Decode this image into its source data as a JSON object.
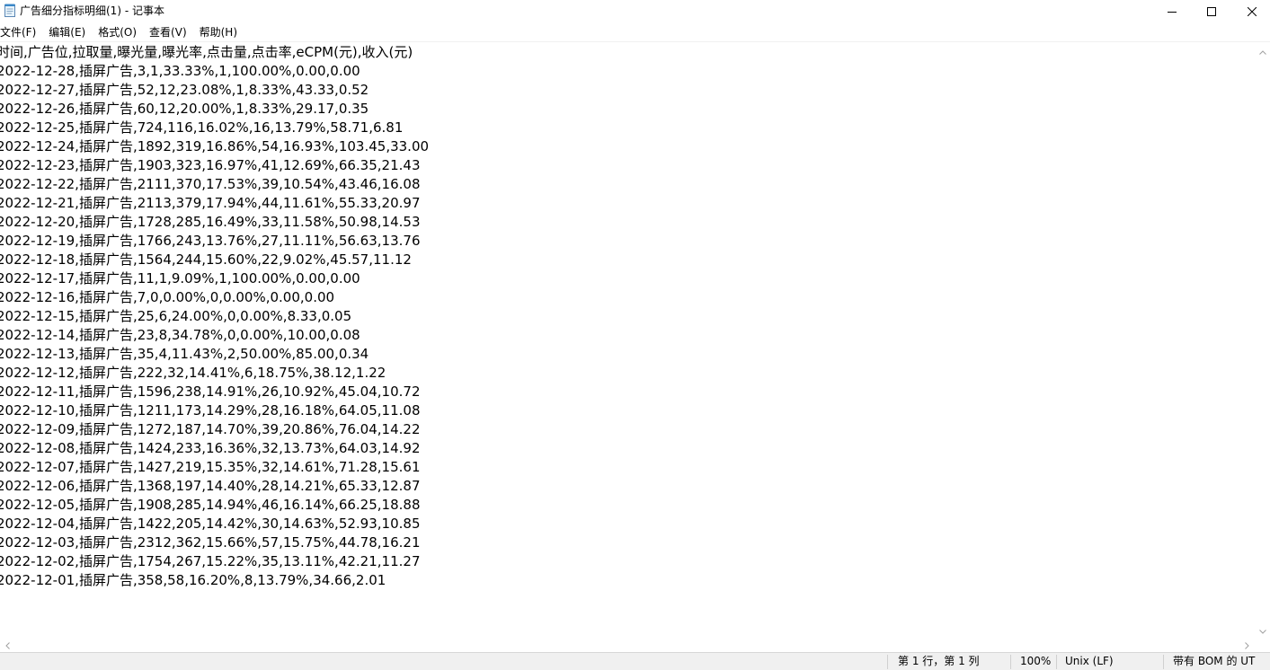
{
  "window": {
    "title": "广告细分指标明细(1) - 记事本"
  },
  "menu": {
    "items": [
      {
        "label": "文件(F)"
      },
      {
        "label": "编辑(E)"
      },
      {
        "label": "格式(O)"
      },
      {
        "label": "查看(V)"
      },
      {
        "label": "帮助(H)"
      }
    ]
  },
  "editor": {
    "lines": [
      "时间,广告位,拉取量,曝光量,曝光率,点击量,点击率,eCPM(元),收入(元)",
      "2022-12-28,插屏广告,3,1,33.33%,1,100.00%,0.00,0.00",
      "2022-12-27,插屏广告,52,12,23.08%,1,8.33%,43.33,0.52",
      "2022-12-26,插屏广告,60,12,20.00%,1,8.33%,29.17,0.35",
      "2022-12-25,插屏广告,724,116,16.02%,16,13.79%,58.71,6.81",
      "2022-12-24,插屏广告,1892,319,16.86%,54,16.93%,103.45,33.00",
      "2022-12-23,插屏广告,1903,323,16.97%,41,12.69%,66.35,21.43",
      "2022-12-22,插屏广告,2111,370,17.53%,39,10.54%,43.46,16.08",
      "2022-12-21,插屏广告,2113,379,17.94%,44,11.61%,55.33,20.97",
      "2022-12-20,插屏广告,1728,285,16.49%,33,11.58%,50.98,14.53",
      "2022-12-19,插屏广告,1766,243,13.76%,27,11.11%,56.63,13.76",
      "2022-12-18,插屏广告,1564,244,15.60%,22,9.02%,45.57,11.12",
      "2022-12-17,插屏广告,11,1,9.09%,1,100.00%,0.00,0.00",
      "2022-12-16,插屏广告,7,0,0.00%,0,0.00%,0.00,0.00",
      "2022-12-15,插屏广告,25,6,24.00%,0,0.00%,8.33,0.05",
      "2022-12-14,插屏广告,23,8,34.78%,0,0.00%,10.00,0.08",
      "2022-12-13,插屏广告,35,4,11.43%,2,50.00%,85.00,0.34",
      "2022-12-12,插屏广告,222,32,14.41%,6,18.75%,38.12,1.22",
      "2022-12-11,插屏广告,1596,238,14.91%,26,10.92%,45.04,10.72",
      "2022-12-10,插屏广告,1211,173,14.29%,28,16.18%,64.05,11.08",
      "2022-12-09,插屏广告,1272,187,14.70%,39,20.86%,76.04,14.22",
      "2022-12-08,插屏广告,1424,233,16.36%,32,13.73%,64.03,14.92",
      "2022-12-07,插屏广告,1427,219,15.35%,32,14.61%,71.28,15.61",
      "2022-12-06,插屏广告,1368,197,14.40%,28,14.21%,65.33,12.87",
      "2022-12-05,插屏广告,1908,285,14.94%,46,16.14%,66.25,18.88",
      "2022-12-04,插屏广告,1422,205,14.42%,30,14.63%,52.93,10.85",
      "2022-12-03,插屏广告,2312,362,15.66%,57,15.75%,44.78,16.21",
      "2022-12-02,插屏广告,1754,267,15.22%,35,13.11%,42.21,11.27",
      "2022-12-01,插屏广告,358,58,16.20%,8,13.79%,34.66,2.01"
    ]
  },
  "statusbar": {
    "position": "第 1 行，第 1 列",
    "zoom": "100%",
    "line_ending": "Unix (LF)",
    "encoding": "带有 BOM 的 UT"
  },
  "icons": {
    "app": "notepad-icon",
    "minimize": "minimize-icon",
    "maximize": "maximize-icon",
    "close": "close-icon"
  }
}
